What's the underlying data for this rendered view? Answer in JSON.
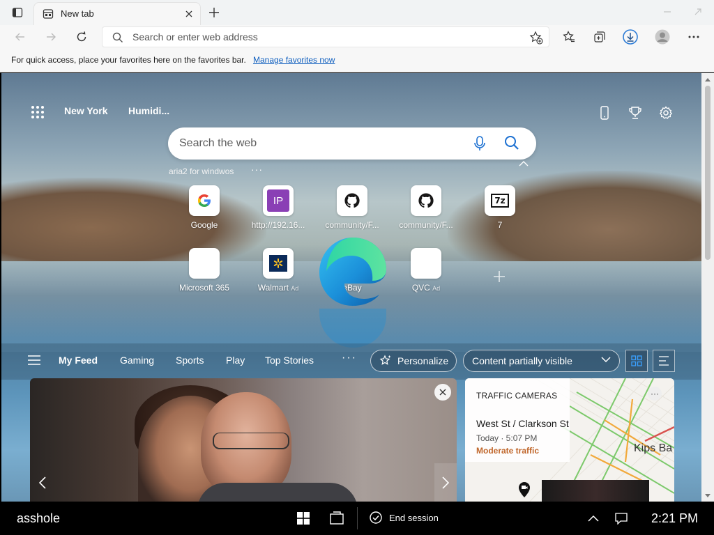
{
  "browser": {
    "tab": {
      "title": "New tab"
    },
    "address_bar": {
      "placeholder": "Search or enter web address"
    },
    "favorites_bar": {
      "hint": "For quick access, place your favorites here on the favorites bar.",
      "manage_link": "Manage favorites now"
    }
  },
  "ntp": {
    "weather": {
      "city": "New York",
      "humidity": "Humidi..."
    },
    "search": {
      "placeholder": "Search the web",
      "recent": "aria2 for windwos"
    },
    "quick_links": [
      {
        "label": "Google",
        "icon": "google-icon",
        "ad": ""
      },
      {
        "label": "http://192.16...",
        "icon": "ip-icon",
        "ad": ""
      },
      {
        "label": "community/F...",
        "icon": "github-icon",
        "ad": ""
      },
      {
        "label": "community/F...",
        "icon": "github-icon",
        "ad": ""
      },
      {
        "label": "7",
        "icon": "7zip-icon",
        "ad": ""
      },
      {
        "label": "Microsoft 365",
        "icon": "office-icon",
        "ad": ""
      },
      {
        "label": "Walmart",
        "icon": "walmart-icon",
        "ad": "Ad"
      },
      {
        "label": "eBay",
        "icon": "ebay-icon",
        "ad": ""
      },
      {
        "label": "QVC",
        "icon": "qvc-icon",
        "ad": "Ad"
      }
    ],
    "feed_nav": {
      "tabs": [
        "My Feed",
        "Gaming",
        "Sports",
        "Play",
        "Top Stories"
      ],
      "personalize": "Personalize",
      "visibility": "Content partially visible"
    },
    "traffic": {
      "title": "TRAFFIC CAMERAS",
      "street": "West St / Clarkson St",
      "time": "Today · 5:07 PM",
      "status": "Moderate traffic",
      "place": "Kips Ba"
    }
  },
  "taskbar": {
    "user": "asshole",
    "end_session": "End session",
    "clock": "2:21 PM"
  },
  "colors": {
    "accent": "#0f5fbf",
    "traffic_status": "#c0662a"
  }
}
